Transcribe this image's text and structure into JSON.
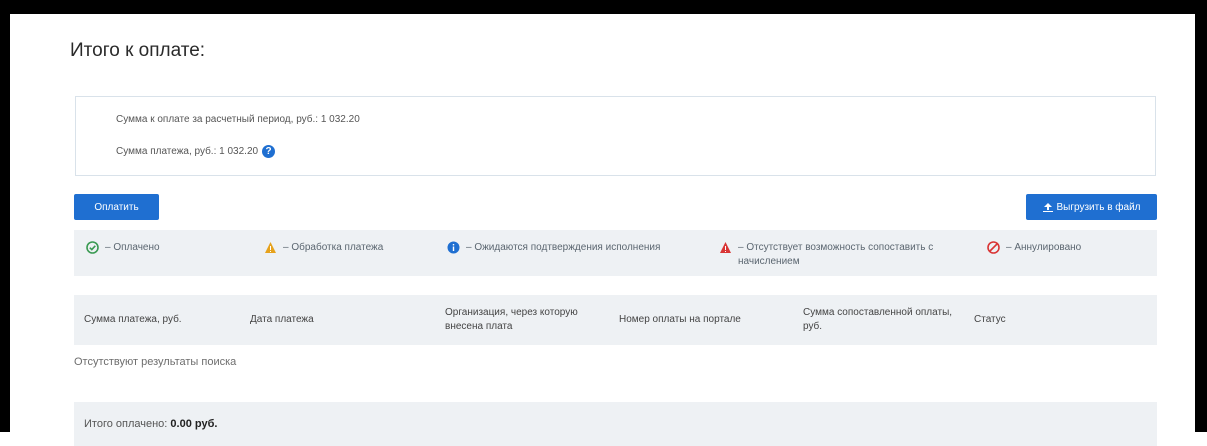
{
  "header": {
    "title": "Итого к оплате:"
  },
  "summary": {
    "line_period": "Сумма к оплате за расчетный период, руб.: 1 032.20",
    "line_payment": "Сумма платежа, руб.: 1 032.20",
    "help_icon": "question-circle-icon"
  },
  "actions": {
    "pay_label": "Оплатить",
    "export_label": "Выгрузить в файл",
    "export_icon": "upload-icon"
  },
  "legend": {
    "items": [
      {
        "label": "– Оплачено",
        "icon": "check-circle-icon",
        "color": "#3a9a52"
      },
      {
        "label": "– Обработка платежа",
        "icon": "warning-triangle-icon",
        "color": "#e6a21c"
      },
      {
        "label": "– Ожидаются подтверждения исполнения",
        "icon": "info-circle-icon",
        "color": "#1f6fd1"
      },
      {
        "label": "– Отсутствует возможность сопоставить с начислением",
        "icon": "warning-triangle-icon",
        "color": "#d93535"
      },
      {
        "label": "– Аннулировано",
        "icon": "cancel-circle-icon",
        "color": "#d93535"
      }
    ]
  },
  "table": {
    "columns": [
      "Сумма платежа, руб.",
      "Дата платежа",
      "Организация, через которую внесена плата",
      "Номер оплаты на портале",
      "Сумма сопоставленной оплаты, руб.",
      "Статус"
    ],
    "empty_text": "Отсутствуют результаты поиска"
  },
  "footer": {
    "label": "Итого оплачено:",
    "value": "0.00 руб."
  },
  "colors": {
    "accent": "#1f6fd1",
    "panel": "#eef1f4"
  }
}
